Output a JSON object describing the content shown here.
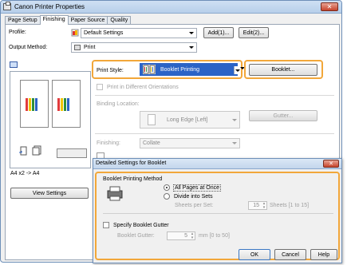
{
  "window": {
    "title": "Canon Printer Properties",
    "close_glyph": "✕"
  },
  "tabs": [
    {
      "label": "Page Setup",
      "active": false
    },
    {
      "label": "Finishing",
      "active": true
    },
    {
      "label": "Paper Source",
      "active": false
    },
    {
      "label": "Quality",
      "active": false
    }
  ],
  "profile": {
    "label": "Profile:",
    "value": "Default Settings",
    "add_button": "Add(1)...",
    "edit_button": "Edit(2)..."
  },
  "output_method": {
    "label": "Output Method:",
    "value": "Print"
  },
  "preview": {
    "caption": "A4 x2 -> A4",
    "view_settings_button": "View Settings"
  },
  "print_style": {
    "label": "Print Style:",
    "value": "Booklet Printing",
    "booklet_button": "Booklet..."
  },
  "print_in_different_orientations": {
    "label": "Print in Different Orientations",
    "checked": false
  },
  "binding_location": {
    "label": "Binding Location:",
    "value": "Long Edge [Left]",
    "gutter_button": "Gutter..."
  },
  "finishing": {
    "label": "Finishing:",
    "value": "Collate"
  },
  "booklet_dialog": {
    "title": "Detailed Settings for Booklet",
    "close_glyph": "✕",
    "method_label": "Booklet Printing Method",
    "all_pages_at_once": "All Pages at Once",
    "divide_into_sets": "Divide into Sets",
    "sheets_per_set_label": "Sheets per Set:",
    "sheets_per_set_value": "15",
    "sheets_range": "Sheets [1 to 15]",
    "specify_gutter_label": "Specify Booklet Gutter",
    "booklet_gutter_label": "Booklet Gutter:",
    "booklet_gutter_value": "5",
    "gutter_range": "mm [0 to 50]",
    "ok_button": "OK",
    "cancel_button": "Cancel",
    "help_button": "Help"
  },
  "colors": {
    "highlight": "#f2a73a",
    "title_blue": "#c3d6ec",
    "booklet_icon_blue": "#2b63c6"
  }
}
